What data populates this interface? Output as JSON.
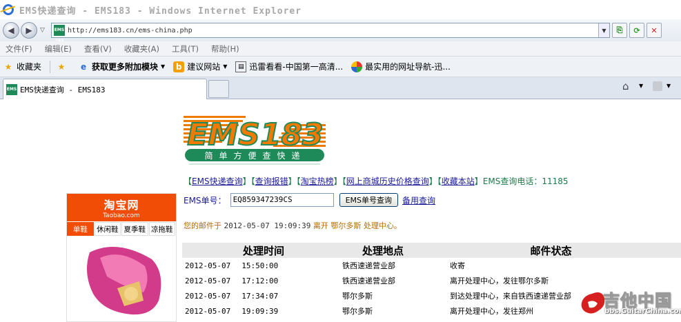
{
  "window": {
    "title": "EMS快递查询 - EMS183 - Windows Internet Explorer"
  },
  "address": {
    "url": "http://ems183.cn/ems-china.php"
  },
  "menu": [
    "文件(F)",
    "编辑(E)",
    "查看(V)",
    "收藏夹(A)",
    "工具(T)",
    "帮助(H)"
  ],
  "favbar": {
    "favorites_label": "收藏夹",
    "addons_label": "获取更多附加模块",
    "suggest_label": "建议网站",
    "link1": "迅雷看看-中国第一高清...",
    "link2": "最实用的网址导航-迅..."
  },
  "tab": {
    "label": "EMS快递查询 - EMS183"
  },
  "logo": {
    "tagline": "简单方便查快递",
    "text": "EMS183",
    "favicon": "EMS 183"
  },
  "nav": {
    "links": [
      "EMS快递查询",
      "查询报错",
      "淘宝热榜",
      "网上商城历史价格查询",
      "收藏本站"
    ],
    "tel_label": "EMS查询电话：",
    "tel": "11185"
  },
  "query": {
    "label": "EMS单号：",
    "value": "EQ859347239CS",
    "button": "EMS单号查询",
    "backup_link": "备用查询"
  },
  "status": {
    "prefix": "您的邮件于",
    "datetime": "2012-05-07 19:09:39",
    "action": "离开",
    "place": "鄂尔多斯",
    "suffix": "处理中心。"
  },
  "table": {
    "headers": [
      "处理时间",
      "处理地点",
      "邮件状态"
    ],
    "rows": [
      {
        "date": "2012-05-07",
        "time": "15:50:00",
        "place": "铁西速递营业部",
        "status": "收寄"
      },
      {
        "date": "2012-05-07",
        "time": "17:12:00",
        "place": "铁西速递营业部",
        "status": "离开处理中心，发往鄂尔多斯"
      },
      {
        "date": "2012-05-07",
        "time": "17:34:07",
        "place": "鄂尔多斯",
        "status": "到达处理中心，来自铁西速递营业部"
      },
      {
        "date": "2012-05-07",
        "time": "19:09:39",
        "place": "鄂尔多斯",
        "status": "离开处理中心，发往郑州"
      }
    ]
  },
  "taobao": {
    "name": "淘宝网",
    "domain": "Taobao.com",
    "tabs": [
      "单鞋",
      "休闲鞋",
      "夏季鞋",
      "凉拖鞋"
    ]
  },
  "watermark": {
    "cn": "吉他中国",
    "en": "bbs.GuitarChina.com"
  },
  "colors": {
    "ems_orange": "#f07a00",
    "ems_green": "#1e8a5a",
    "taobao_orange": "#f24d06",
    "link_blue": "#1a1a9a"
  }
}
